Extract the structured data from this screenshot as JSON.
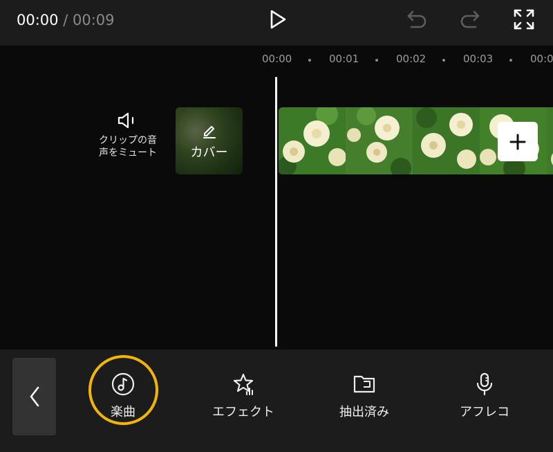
{
  "player": {
    "current_time": "00:00",
    "separator": " / ",
    "total_time": "00:09"
  },
  "toolbar_icons": [
    "play-icon",
    "undo-icon",
    "redo-icon",
    "fullscreen-icon"
  ],
  "ruler": {
    "ticks": [
      "00:00",
      "00:01",
      "00:02",
      "00:03",
      "00:0"
    ]
  },
  "track": {
    "mute_label_line1": "クリップの音",
    "mute_label_line2": "声をミュート",
    "cover_label": "カバー"
  },
  "bottom_tools": [
    {
      "label": "楽曲",
      "icon": "music-note-icon",
      "highlighted": true
    },
    {
      "label": "エフェクト",
      "icon": "sparkle-star-icon"
    },
    {
      "label": "抽出済み",
      "icon": "folder-icon"
    },
    {
      "label": "アフレコ",
      "icon": "microphone-icon"
    }
  ],
  "colors": {
    "highlight_ring": "#f2b600",
    "background": "#0a0a0a",
    "bar": "#1c1c1c"
  }
}
